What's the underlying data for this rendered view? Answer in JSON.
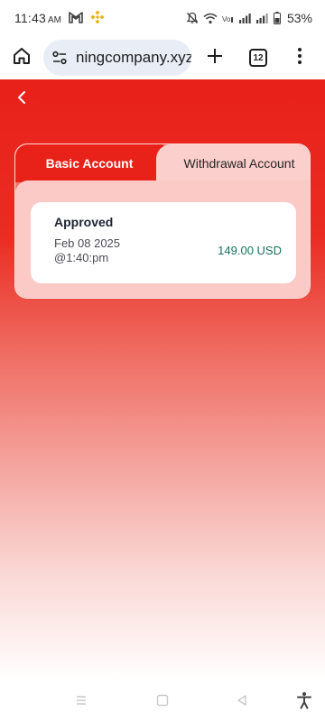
{
  "status_bar": {
    "time": "11:43",
    "ampm": "AM",
    "battery_percent": "53%",
    "icons": [
      "gmail-icon",
      "binance-icon",
      "mute-icon",
      "wifi-icon",
      "volte-icon",
      "signal-icon",
      "signal-icon",
      "battery-icon"
    ]
  },
  "browser": {
    "url": "ningcompany.xyz",
    "tab_count": "12",
    "icons": [
      "home-icon",
      "site-settings-icon",
      "new-tab-icon",
      "tab-switcher-icon",
      "overflow-menu-icon"
    ]
  },
  "page": {
    "tabs": [
      {
        "label": "Basic Account",
        "active": false
      },
      {
        "label": "Withdrawal Account",
        "active": true
      }
    ],
    "records": [
      {
        "status": "Approved",
        "date_line1": "Feb 08 2025",
        "date_line2": "@1:40:pm",
        "amount": "149.00 USD"
      }
    ]
  },
  "colors": {
    "brand_red": "#e8211a",
    "amount_green": "#17735a",
    "tab_inactive_bg": "#fbcfcc"
  },
  "nav_bar": {
    "icons": [
      "recents-icon",
      "home-nav-icon",
      "back-nav-icon",
      "accessibility-icon"
    ]
  }
}
